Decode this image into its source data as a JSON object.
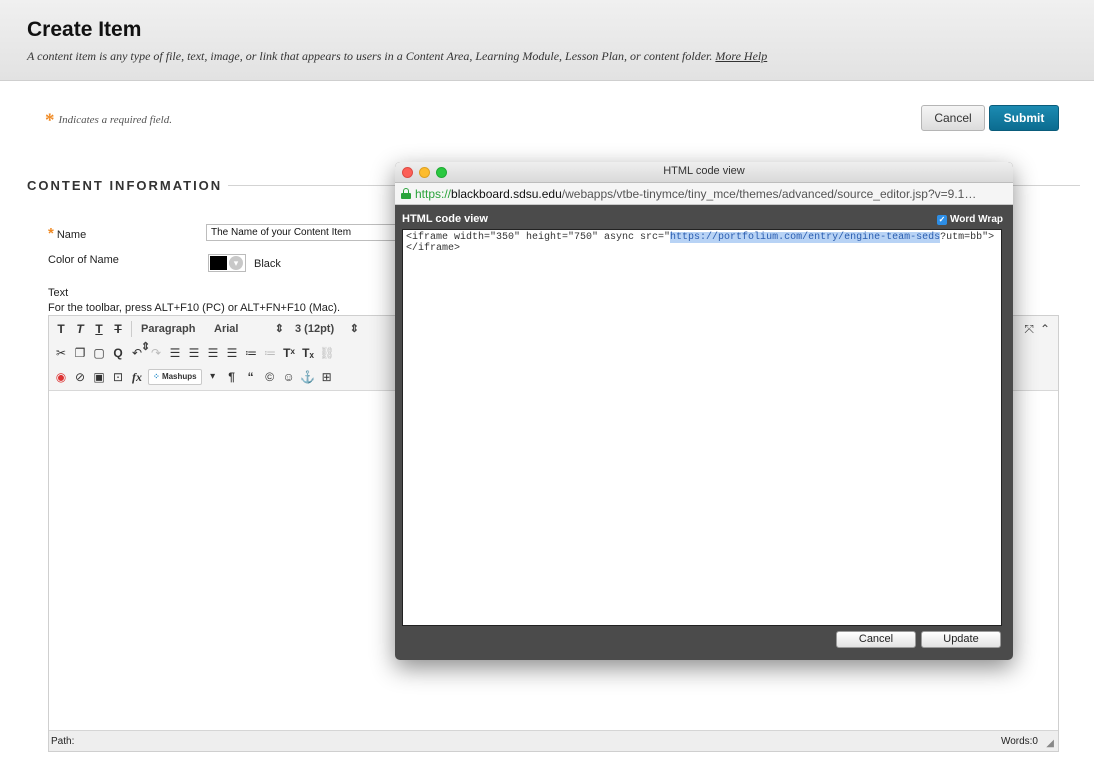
{
  "header": {
    "title": "Create Item",
    "description": "A content item is any type of file, text, image, or link that appears to users in a Content Area, Learning Module, Lesson Plan, or content folder.",
    "help_link": "More Help"
  },
  "required_note": {
    "star": "*",
    "text": "Indicates a required field."
  },
  "actions": {
    "cancel_label": "Cancel",
    "submit_label": "Submit"
  },
  "section": {
    "title": "CONTENT INFORMATION"
  },
  "form": {
    "name_label": "Name",
    "name_value": "The Name of your Content Item",
    "color_label": "Color of Name",
    "color_value": "Black",
    "text_label": "Text",
    "toolbar_hint": "For the toolbar, press ALT+F10 (PC) or ALT+FN+F10 (Mac)."
  },
  "editor": {
    "format_select": "Paragraph",
    "font_select": "Arial",
    "size_select": "3 (12pt)",
    "mashups_label": "Mashups",
    "path_label": "Path:",
    "words_label": "Words:0"
  },
  "modal": {
    "window_title": "HTML code view",
    "url_proto": "https://",
    "url_host": "blackboard.sdsu.edu",
    "url_rest": "/webapps/vtbe-tinymce/tiny_mce/themes/advanced/source_editor.jsp?v=9.1…",
    "inner_title": "HTML code view",
    "word_wrap_label": "Word Wrap",
    "code_before": "<iframe width=\"350\" height=\"750\" async src=\"",
    "code_selected": "https://portfolium.com/entry/engine-team-seds",
    "code_after": "?utm=bb\"></iframe>",
    "cancel_label": "Cancel",
    "update_label": "Update"
  },
  "colors": {
    "accent": "#0b6c90",
    "required": "#f08a24",
    "selection": "#b8d3f5"
  },
  "icons": [
    "lock-icon",
    "bold-icon",
    "italic-icon",
    "underline-icon",
    "strikethrough-icon",
    "cut-icon",
    "copy-icon",
    "paste-icon",
    "find-icon",
    "undo-icon",
    "redo-icon",
    "align-left-icon",
    "align-center-icon",
    "align-right-icon",
    "align-justify-icon",
    "bullet-list-icon",
    "number-list-icon",
    "superscript-icon",
    "subscript-icon",
    "link-icon",
    "unlink-icon",
    "record-icon",
    "attach-icon",
    "image-icon",
    "media-icon",
    "formula-icon",
    "pilcrow-icon",
    "quote-icon",
    "copyright-icon",
    "emoji-icon",
    "anchor-icon",
    "table-icon",
    "fullscreen-icon",
    "collapse-icon",
    "checkbox-icon"
  ]
}
